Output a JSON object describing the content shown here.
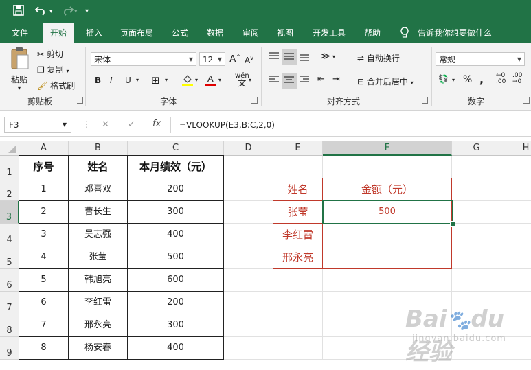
{
  "quick_access": {
    "save_icon": "save-icon",
    "undo_icon": "undo-icon",
    "redo_icon": "redo-icon",
    "customize": "▾"
  },
  "tabs": [
    {
      "label": "文件"
    },
    {
      "label": "开始"
    },
    {
      "label": "插入"
    },
    {
      "label": "页面布局"
    },
    {
      "label": "公式"
    },
    {
      "label": "数据"
    },
    {
      "label": "审阅"
    },
    {
      "label": "视图"
    },
    {
      "label": "开发工具"
    },
    {
      "label": "帮助"
    },
    {
      "label": "告诉我你想要做什么"
    }
  ],
  "ribbon": {
    "clipboard": {
      "paste": "粘贴",
      "cut": "剪切",
      "copy": "复制",
      "format_painter": "格式刷",
      "label": "剪贴板"
    },
    "font": {
      "font_name": "宋体",
      "font_size": "12",
      "bold": "B",
      "italic": "I",
      "underline": "U",
      "wen": "wén",
      "label": "字体"
    },
    "alignment": {
      "wrap": "自动换行",
      "merge": "合并后居中",
      "label": "对齐方式"
    },
    "number": {
      "format": "常规",
      "percent": "%",
      "comma": ",",
      "label": "数字"
    }
  },
  "formula_bar": {
    "name_box": "F3",
    "cancel": "✕",
    "enter": "✓",
    "fx": "fx",
    "formula": "=VLOOKUP(E3,B:C,2,0)"
  },
  "columns": [
    "A",
    "B",
    "C",
    "D",
    "E",
    "F",
    "G",
    "H"
  ],
  "rows": [
    "1",
    "2",
    "3",
    "4",
    "5",
    "6",
    "7",
    "8",
    "9"
  ],
  "table1": {
    "headers": [
      "序号",
      "姓名",
      "本月绩效（元）"
    ],
    "rows": [
      [
        "1",
        "邓喜双",
        "200"
      ],
      [
        "2",
        "曹长生",
        "300"
      ],
      [
        "3",
        "吴志强",
        "400"
      ],
      [
        "4",
        "张莹",
        "500"
      ],
      [
        "5",
        "韩旭亮",
        "600"
      ],
      [
        "6",
        "李红雷",
        "200"
      ],
      [
        "7",
        "邢永亮",
        "300"
      ],
      [
        "8",
        "杨安春",
        "400"
      ]
    ]
  },
  "table2": {
    "headers": [
      "姓名",
      "金额（元）"
    ],
    "rows": [
      [
        "张莹",
        "500"
      ],
      [
        "李红雷",
        ""
      ],
      [
        "邢永亮",
        ""
      ]
    ]
  },
  "watermark": {
    "logo": "Baidu 经验",
    "url": "jingyan.baidu.com"
  }
}
